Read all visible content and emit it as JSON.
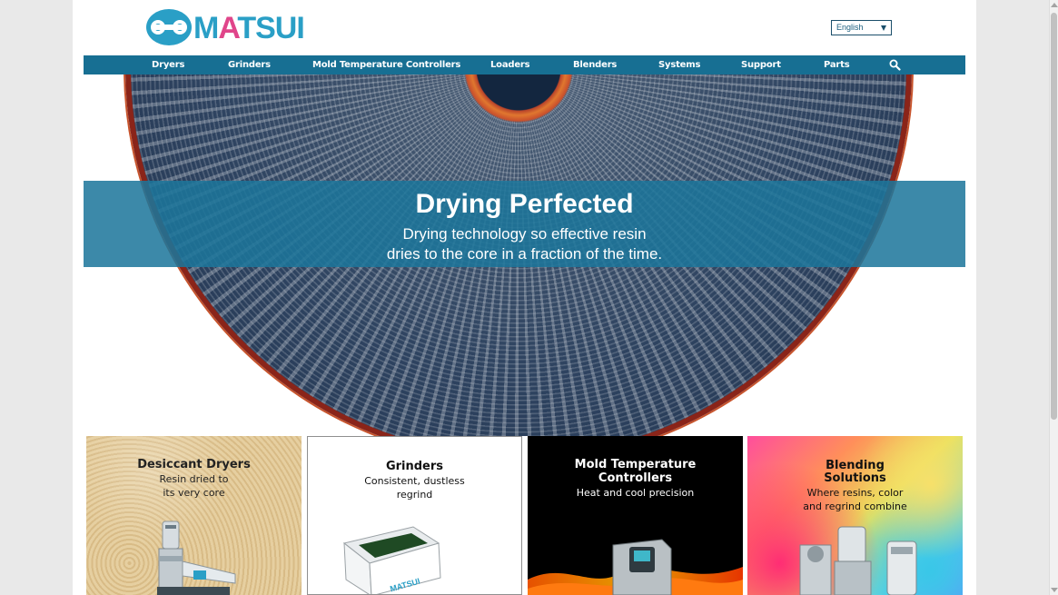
{
  "header": {
    "logo_text_a": "M",
    "logo_text_b": "A",
    "logo_text_c": "TSUI",
    "language": "English"
  },
  "nav": {
    "items": [
      "Dryers",
      "Grinders",
      "Mold Temperature Controllers",
      "Loaders",
      "Blenders",
      "Systems",
      "Support",
      "Parts"
    ],
    "search_icon": "search-icon"
  },
  "hero": {
    "title": "Drying Perfected",
    "subtitle_line1": "Drying technology so effective resin",
    "subtitle_line2": "dries to the core in a fraction of the time."
  },
  "cards": [
    {
      "title": "Desiccant Dryers",
      "sub1": "Resin dried to",
      "sub2": "its very core"
    },
    {
      "title": "Grinders",
      "sub1": "Consistent, dustless",
      "sub2": "regrind"
    },
    {
      "title1": "Mold Temperature",
      "title2": "Controllers",
      "sub1": "Heat and cool precision"
    },
    {
      "title1": "Blending",
      "title2": "Solutions",
      "sub1": "Where resins, color",
      "sub2": "and regrind combine"
    }
  ],
  "grinder_label": "MATSUI",
  "colors": {
    "brand_blue": "#2a9fc6",
    "brand_pink": "#e0458a",
    "nav_bg": "#176f93",
    "banner_bg": "#1c769b"
  }
}
